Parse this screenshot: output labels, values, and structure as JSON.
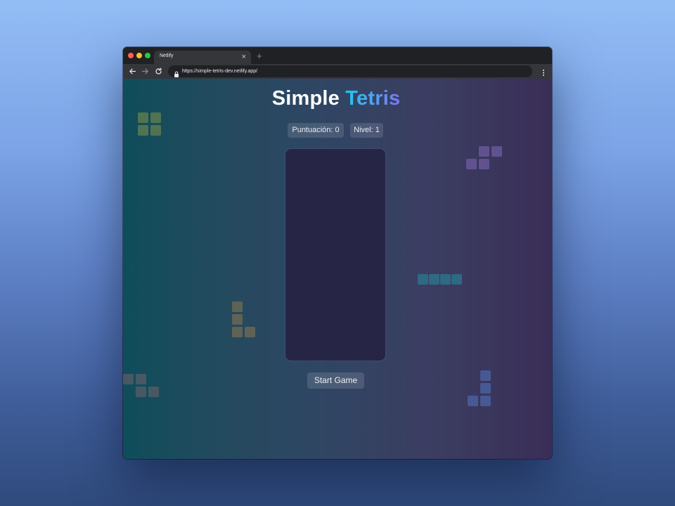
{
  "browser": {
    "tab_title": "Netlify",
    "tab_close_icon": "×",
    "new_tab_icon": "+",
    "url": "https://simple-tetris-dev.netlify.app/"
  },
  "page": {
    "title_main": "Simple",
    "title_accent": "Tetris",
    "score_label": "Puntuación: 0",
    "level_label": "Nivel: 1",
    "start_button": "Start Game"
  },
  "colors": {
    "title_accent_start": "#1cc6ec",
    "title_accent_end": "#7b77ee",
    "board": "#262546",
    "piece_o": "#5c7a4f",
    "piece_s": "#6a5a9c",
    "piece_i": "#2f6f88",
    "piece_l": "#6b6655",
    "piece_z": "#4f5a66",
    "piece_j": "#4a5f9e"
  },
  "icons": [
    "back-arrow-icon",
    "forward-arrow-icon",
    "reload-icon",
    "lock-icon",
    "more-vertical-icon",
    "close-icon",
    "plus-icon"
  ]
}
